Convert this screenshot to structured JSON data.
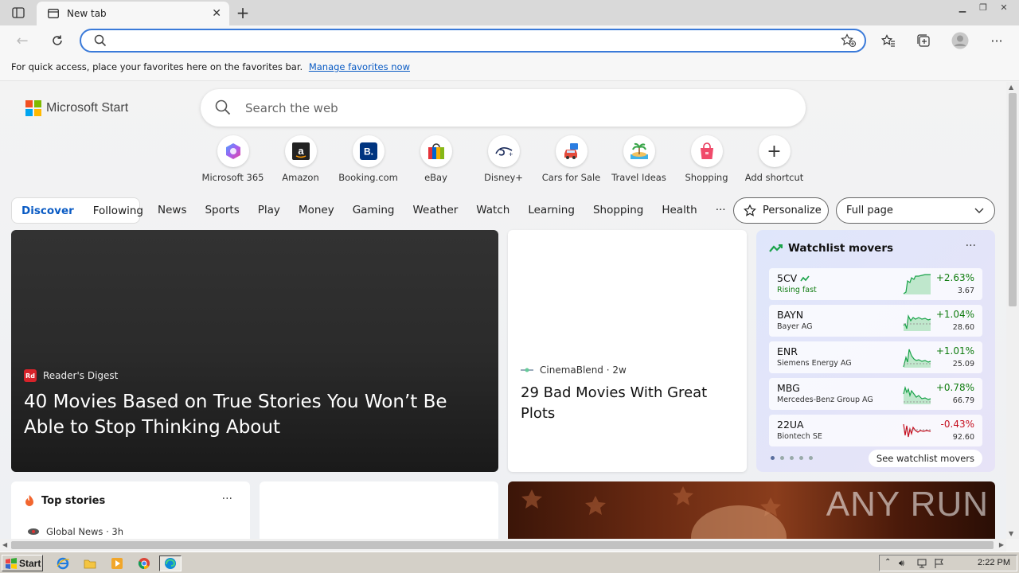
{
  "browser": {
    "tab_title": "New tab",
    "address_value": "",
    "favorites_hint": "For quick access, place your favorites here on the favorites bar.",
    "favorites_link": "Manage favorites now"
  },
  "page": {
    "brand": "Microsoft Start",
    "search_placeholder": "Search the web",
    "shortcuts": [
      {
        "label": "Microsoft 365",
        "icon": "microsoft365-icon"
      },
      {
        "label": "Amazon",
        "icon": "amazon-icon"
      },
      {
        "label": "Booking.com",
        "icon": "booking-icon"
      },
      {
        "label": "eBay",
        "icon": "ebay-icon"
      },
      {
        "label": "Disney+",
        "icon": "disney-plus-icon"
      },
      {
        "label": "Cars for Sale",
        "icon": "car-icon"
      },
      {
        "label": "Travel Ideas",
        "icon": "island-icon"
      },
      {
        "label": "Shopping",
        "icon": "shopping-bag-icon"
      },
      {
        "label": "Add shortcut",
        "icon": "plus-icon"
      }
    ],
    "feed_tabs": [
      "Discover",
      "Following"
    ],
    "categories": [
      "News",
      "Sports",
      "Play",
      "Money",
      "Gaming",
      "Weather",
      "Watch",
      "Learning",
      "Shopping",
      "Health",
      "···"
    ],
    "personalize": "Personalize",
    "layout_select": "Full page"
  },
  "hero": {
    "source": "Reader's Digest",
    "source_badge": "Rd",
    "headline": "40 Movies Based on True Stories You Won’t Be Able to Stop Thinking About"
  },
  "card2": {
    "source": "CinemaBlend · 2w",
    "headline": "29 Bad Movies With Great Plots"
  },
  "watchlist": {
    "title": "Watchlist movers",
    "more": "···",
    "stocks": [
      {
        "symbol": "5CV",
        "name": "Rising fast",
        "change": "+2.63%",
        "price": "3.67",
        "dir": "up"
      },
      {
        "symbol": "BAYN",
        "name": "Bayer AG",
        "change": "+1.04%",
        "price": "28.60",
        "dir": "up"
      },
      {
        "symbol": "ENR",
        "name": "Siemens Energy AG",
        "change": "+1.01%",
        "price": "25.09",
        "dir": "up"
      },
      {
        "symbol": "MBG",
        "name": "Mercedes-Benz Group AG",
        "change": "+0.78%",
        "price": "66.79",
        "dir": "up"
      },
      {
        "symbol": "22UA",
        "name": "Biontech SE",
        "change": "-0.43%",
        "price": "92.60",
        "dir": "down"
      }
    ],
    "see_more": "See watchlist movers"
  },
  "top_stories": {
    "title": "Top stories",
    "more": "···",
    "first_source": "Global News · 3h"
  },
  "watermark": "ANY RUN",
  "taskbar": {
    "start": "Start",
    "clock": "2:22 PM"
  }
}
